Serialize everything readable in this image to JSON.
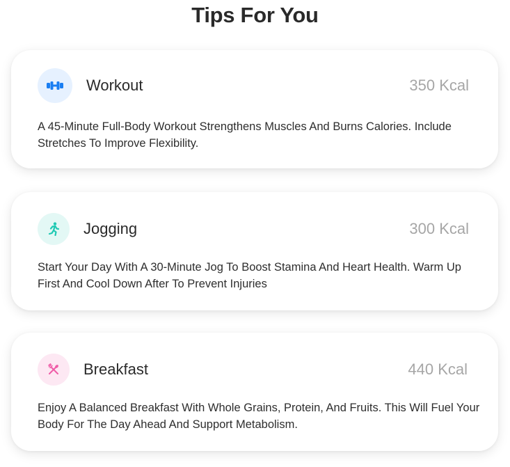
{
  "page": {
    "title": "Tips For You"
  },
  "tips": [
    {
      "name": "Workout",
      "kcal": "350 Kcal",
      "description": "A 45-Minute Full-Body Workout Strengthens Muscles And Burns Calories. Include Stretches To Improve Flexibility.",
      "icon": "dumbbell-icon",
      "icon_color": "#1a7ef2",
      "icon_bg": "#e6f1ff"
    },
    {
      "name": "Jogging",
      "kcal": "300 Kcal",
      "description": "Start Your Day With A 30-Minute Jog To Boost Stamina And Heart Health. Warm Up First And Cool Down After To Prevent Injuries",
      "icon": "running-person-icon",
      "icon_color": "#1fc9b3",
      "icon_bg": "#e3f8f5"
    },
    {
      "name": "Breakfast",
      "kcal": "440 Kcal",
      "description": "Enjoy A Balanced Breakfast With Whole Grains, Protein, And Fruits. This Will Fuel Your Body For The Day Ahead And Support Metabolism.",
      "icon": "fork-spoon-icon",
      "icon_color": "#ef5da8",
      "icon_bg": "#fde8f3"
    }
  ]
}
